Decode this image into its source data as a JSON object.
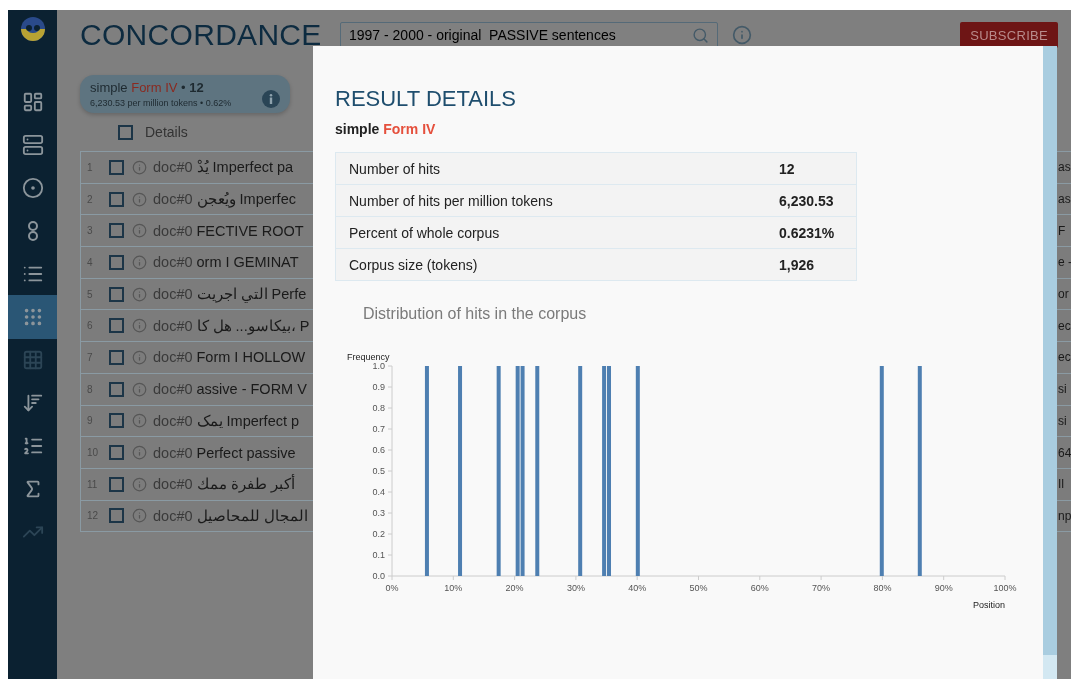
{
  "app": {
    "title": "CONCORDANCE",
    "search": {
      "value": "1997 - 2000 - original  PASSIVE sentences"
    },
    "subscribe": "SUBSCRIBE"
  },
  "sidebar": {
    "items": [
      {
        "selected": false,
        "disabled": false
      },
      {
        "selected": false,
        "disabled": false
      },
      {
        "selected": false,
        "disabled": false
      },
      {
        "selected": false,
        "disabled": false
      },
      {
        "selected": false,
        "disabled": false
      },
      {
        "selected": true,
        "disabled": false
      },
      {
        "selected": false,
        "disabled": true
      },
      {
        "selected": false,
        "disabled": false
      },
      {
        "selected": false,
        "disabled": false
      },
      {
        "selected": false,
        "disabled": false
      },
      {
        "selected": false,
        "disabled": true
      }
    ]
  },
  "query_badge": {
    "title_parts": [
      {
        "kind": "plain",
        "text": "simple"
      },
      {
        "kind": "highlight",
        "text": "Form IV"
      },
      {
        "kind": "plain",
        "text": "•"
      },
      {
        "kind": "bold",
        "text": "12"
      }
    ],
    "stats": "6,230.53 per million tokens • 0.62%"
  },
  "results": {
    "header": {
      "label": "Details",
      "checked": false
    },
    "rows": [
      {
        "number": "1",
        "checked": false,
        "doc": "doc#0",
        "snippet": "يُدْ Imperfect pa",
        "tail": "as"
      },
      {
        "number": "2",
        "checked": false,
        "doc": "doc#0",
        "snippet": "ويُعجن Imperfec",
        "tail": "as"
      },
      {
        "number": "3",
        "checked": false,
        "doc": "doc#0",
        "snippet": "FECTIVE ROOT",
        "tail": "F"
      },
      {
        "number": "4",
        "checked": false,
        "doc": "doc#0",
        "snippet": "orm I GEMINAT",
        "tail": "e -"
      },
      {
        "number": "5",
        "checked": false,
        "doc": "doc#0",
        "snippet": "التي اجريت Perfe",
        "tail": "or"
      },
      {
        "number": "6",
        "checked": false,
        "doc": "doc#0",
        "snippet": "بيكاسو... هل كا، P",
        "tail": "ec"
      },
      {
        "number": "7",
        "checked": false,
        "doc": "doc#0",
        "snippet": "Form I HOLLOW",
        "tail": "ec"
      },
      {
        "number": "8",
        "checked": false,
        "doc": "doc#0",
        "snippet": "assive - FORM V",
        "tail": "si"
      },
      {
        "number": "9",
        "checked": false,
        "doc": "doc#0",
        "snippet": "يمک Imperfect p",
        "tail": "si"
      },
      {
        "number": "10",
        "checked": false,
        "doc": "doc#0",
        "snippet": "Perfect passive",
        "tail": "64"
      },
      {
        "number": "11",
        "checked": false,
        "doc": "doc#0",
        "snippet": "أكبر طفرة ممك",
        "tail": "اا"
      },
      {
        "number": "12",
        "checked": false,
        "doc": "doc#0",
        "snippet": "المجال للمحاصيل",
        "tail": "np"
      }
    ]
  },
  "modal": {
    "title": "RESULT DETAILS",
    "subtitle_parts": [
      {
        "kind": "plain",
        "text": "simple"
      },
      {
        "kind": "highlight",
        "text": "Form IV"
      }
    ],
    "stats": [
      {
        "label": "Number of hits",
        "value": "12"
      },
      {
        "label": "Number of hits per million tokens",
        "value": "6,230.53"
      },
      {
        "label": "Percent of whole corpus",
        "value": "0.6231%"
      },
      {
        "label": "Corpus size (tokens)",
        "value": "1,926"
      }
    ],
    "chart_title": "Distribution of hits in the corpus",
    "chart_data": {
      "type": "bar",
      "ylabel": "Frequency",
      "xlabel": "Position",
      "x": [
        5.7,
        11.1,
        17.4,
        20.5,
        21.3,
        23.7,
        30.7,
        34.6,
        35.4,
        40.1,
        79.9,
        86.1
      ],
      "series": [
        {
          "color": "#4e7fb1",
          "values": [
            1,
            1,
            1,
            1,
            1,
            1,
            1,
            1,
            1,
            1,
            1,
            1
          ]
        }
      ],
      "xlim": [
        0,
        100
      ],
      "ylim": [
        0,
        1
      ],
      "xticks": [
        {
          "value": 0,
          "label": "0%"
        },
        {
          "value": 10,
          "label": "10%"
        },
        {
          "value": 20,
          "label": "20%"
        },
        {
          "value": 30,
          "label": "30%"
        },
        {
          "value": 40,
          "label": "40%"
        },
        {
          "value": 50,
          "label": "50%"
        },
        {
          "value": 60,
          "label": "60%"
        },
        {
          "value": 70,
          "label": "70%"
        },
        {
          "value": 80,
          "label": "80%"
        },
        {
          "value": 90,
          "label": "90%"
        },
        {
          "value": 100,
          "label": "100%"
        }
      ],
      "yticks": [
        {
          "value": 0,
          "label": "0.0"
        },
        {
          "value": 0.1,
          "label": "0.1"
        },
        {
          "value": 0.2,
          "label": "0.2"
        },
        {
          "value": 0.3,
          "label": "0.3"
        },
        {
          "value": 0.4,
          "label": "0.4"
        },
        {
          "value": 0.5,
          "label": "0.5"
        },
        {
          "value": 0.6,
          "label": "0.6"
        },
        {
          "value": 0.7,
          "label": "0.7"
        },
        {
          "value": 0.8,
          "label": "0.8"
        },
        {
          "value": 0.9,
          "label": "0.9"
        },
        {
          "value": 1,
          "label": "1.0"
        }
      ]
    }
  }
}
